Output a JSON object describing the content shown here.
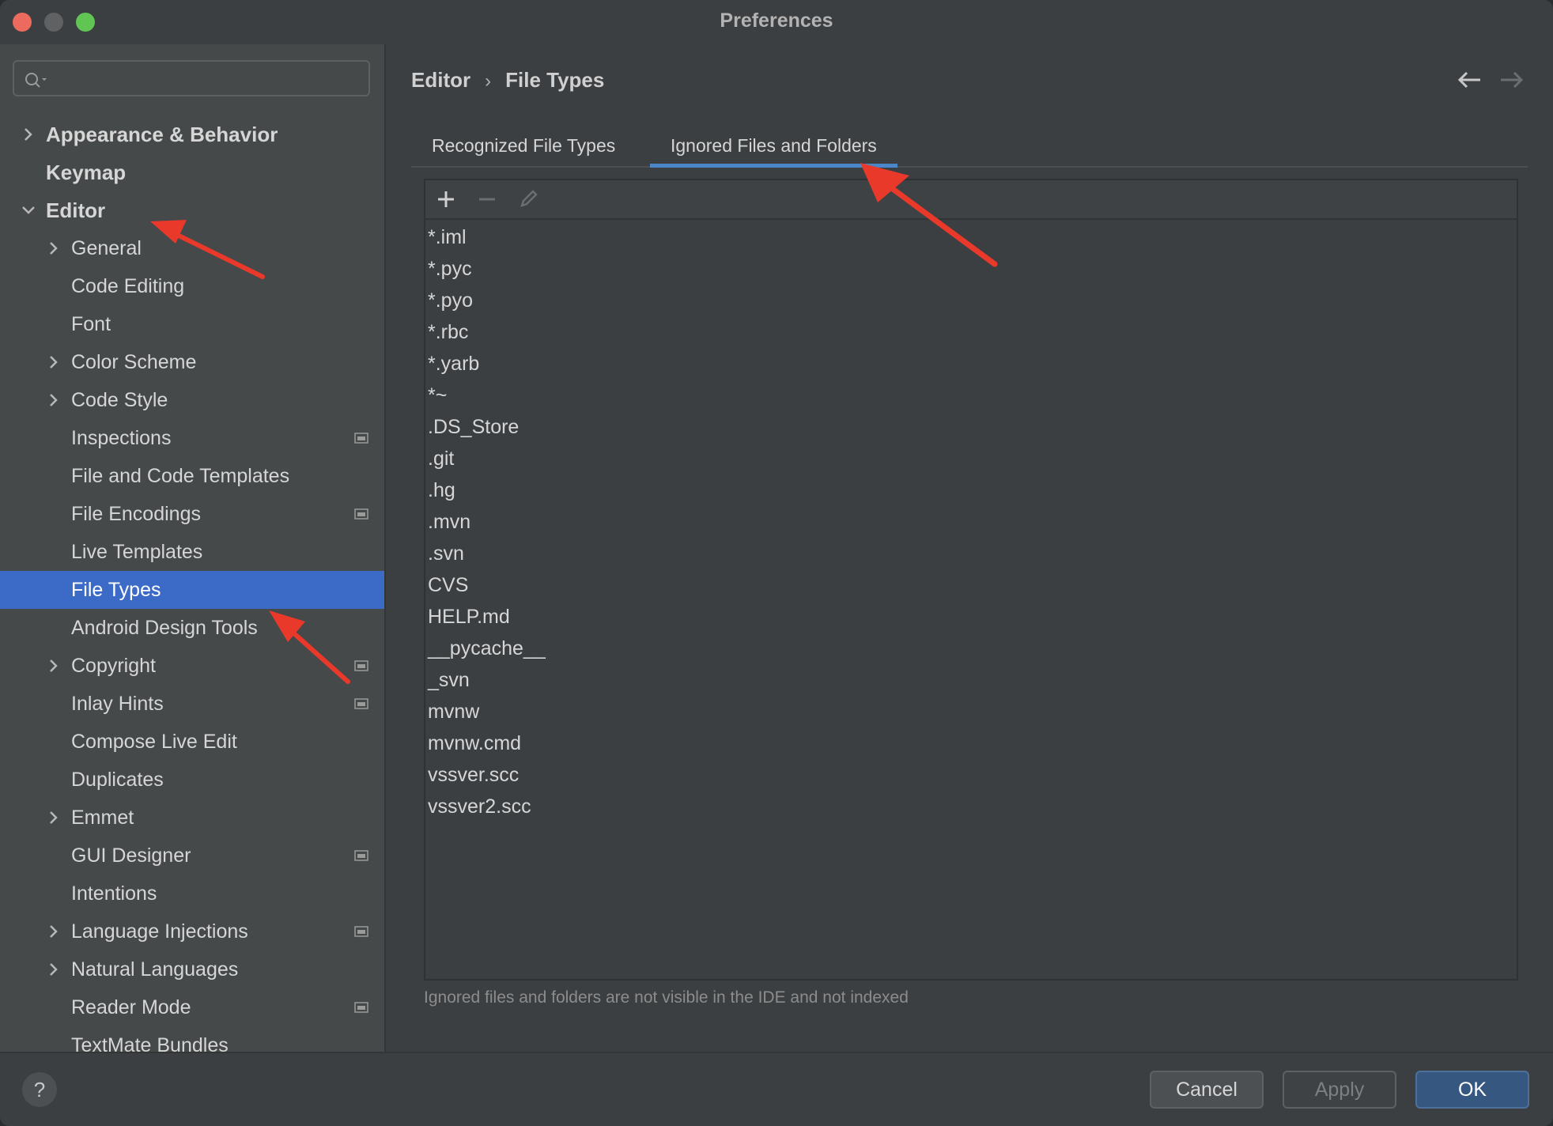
{
  "window": {
    "title": "Preferences"
  },
  "sidebar": {
    "search": {
      "placeholder": ""
    },
    "items": [
      {
        "label": "Appearance & Behavior",
        "level": 0,
        "bold": true,
        "chevron": "right",
        "selected": false,
        "icon": false
      },
      {
        "label": "Keymap",
        "level": 0,
        "bold": true,
        "chevron": "none",
        "selected": false,
        "icon": false
      },
      {
        "label": "Editor",
        "level": 0,
        "bold": true,
        "chevron": "down",
        "selected": false,
        "icon": false
      },
      {
        "label": "General",
        "level": 1,
        "bold": false,
        "chevron": "right",
        "selected": false,
        "icon": false
      },
      {
        "label": "Code Editing",
        "level": 1,
        "bold": false,
        "chevron": "none",
        "selected": false,
        "icon": false
      },
      {
        "label": "Font",
        "level": 1,
        "bold": false,
        "chevron": "none",
        "selected": false,
        "icon": false
      },
      {
        "label": "Color Scheme",
        "level": 1,
        "bold": false,
        "chevron": "right",
        "selected": false,
        "icon": false
      },
      {
        "label": "Code Style",
        "level": 1,
        "bold": false,
        "chevron": "right",
        "selected": false,
        "icon": false
      },
      {
        "label": "Inspections",
        "level": 1,
        "bold": false,
        "chevron": "none",
        "selected": false,
        "icon": true
      },
      {
        "label": "File and Code Templates",
        "level": 1,
        "bold": false,
        "chevron": "none",
        "selected": false,
        "icon": false
      },
      {
        "label": "File Encodings",
        "level": 1,
        "bold": false,
        "chevron": "none",
        "selected": false,
        "icon": true
      },
      {
        "label": "Live Templates",
        "level": 1,
        "bold": false,
        "chevron": "none",
        "selected": false,
        "icon": false
      },
      {
        "label": "File Types",
        "level": 1,
        "bold": false,
        "chevron": "none",
        "selected": true,
        "icon": false
      },
      {
        "label": "Android Design Tools",
        "level": 1,
        "bold": false,
        "chevron": "none",
        "selected": false,
        "icon": false
      },
      {
        "label": "Copyright",
        "level": 1,
        "bold": false,
        "chevron": "right",
        "selected": false,
        "icon": true
      },
      {
        "label": "Inlay Hints",
        "level": 1,
        "bold": false,
        "chevron": "none",
        "selected": false,
        "icon": true
      },
      {
        "label": "Compose Live Edit",
        "level": 1,
        "bold": false,
        "chevron": "none",
        "selected": false,
        "icon": false
      },
      {
        "label": "Duplicates",
        "level": 1,
        "bold": false,
        "chevron": "none",
        "selected": false,
        "icon": false
      },
      {
        "label": "Emmet",
        "level": 1,
        "bold": false,
        "chevron": "right",
        "selected": false,
        "icon": false
      },
      {
        "label": "GUI Designer",
        "level": 1,
        "bold": false,
        "chevron": "none",
        "selected": false,
        "icon": true
      },
      {
        "label": "Intentions",
        "level": 1,
        "bold": false,
        "chevron": "none",
        "selected": false,
        "icon": false
      },
      {
        "label": "Language Injections",
        "level": 1,
        "bold": false,
        "chevron": "right",
        "selected": false,
        "icon": true
      },
      {
        "label": "Natural Languages",
        "level": 1,
        "bold": false,
        "chevron": "right",
        "selected": false,
        "icon": false
      },
      {
        "label": "Reader Mode",
        "level": 1,
        "bold": false,
        "chevron": "none",
        "selected": false,
        "icon": true
      },
      {
        "label": "TextMate Bundles",
        "level": 1,
        "bold": false,
        "chevron": "none",
        "selected": false,
        "icon": false
      }
    ]
  },
  "main": {
    "breadcrumb": {
      "parent": "Editor",
      "separator": "›",
      "current": "File Types"
    },
    "tabs": [
      {
        "label": "Recognized File Types",
        "active": false
      },
      {
        "label": "Ignored Files and Folders",
        "active": true
      }
    ],
    "toolbar": {
      "add_icon": "plus-icon",
      "remove_icon": "minus-icon",
      "edit_icon": "pencil-icon"
    },
    "ignored_items": [
      "*.iml",
      "*.pyc",
      "*.pyo",
      "*.rbc",
      "*.yarb",
      "*~",
      ".DS_Store",
      ".git",
      ".hg",
      ".mvn",
      ".svn",
      "CVS",
      "HELP.md",
      "__pycache__",
      "_svn",
      "mvnw",
      "mvnw.cmd",
      "vssver.scc",
      "vssver2.scc"
    ],
    "hint": "Ignored files and folders are not visible in the IDE and not indexed"
  },
  "footer": {
    "help_label": "?",
    "cancel_label": "Cancel",
    "apply_label": "Apply",
    "ok_label": "OK"
  },
  "colors": {
    "selection": "#3b6ac7",
    "active_tab_underline": "#4a86c8",
    "annotation_arrow": "#e8392b"
  }
}
